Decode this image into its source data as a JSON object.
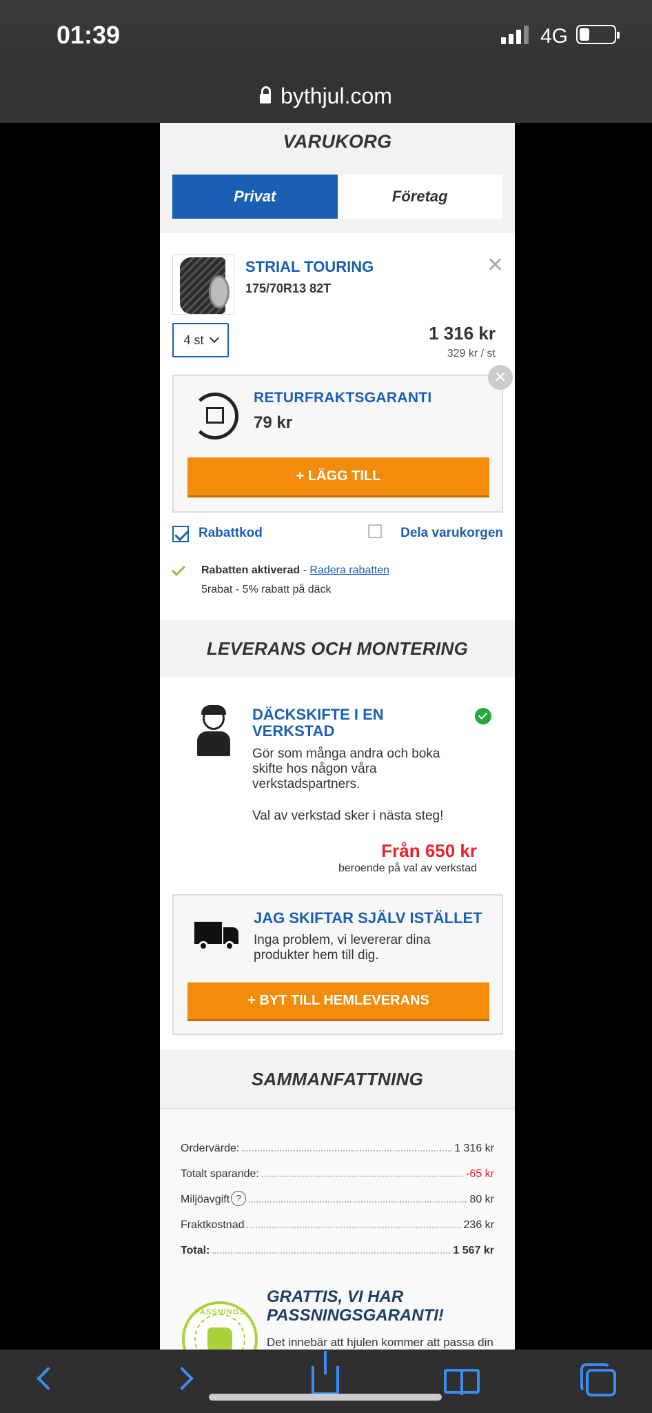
{
  "status": {
    "time": "01:39",
    "network": "4G"
  },
  "browser": {
    "url": "bythjul.com"
  },
  "cart": {
    "title": "VARUKORG",
    "tabs": {
      "private": "Privat",
      "business": "Företag"
    },
    "item": {
      "name": "STRIAL TOURING",
      "size": "175/70R13 82T",
      "qty": "4 st",
      "price": "1 316 kr",
      "unit_price": "329 kr / st"
    },
    "return_guarantee": {
      "title": "RETURFRAKTSGARANTI",
      "price": "79 kr",
      "add_label": "+ LÄGG TILL"
    },
    "discount_label": "Rabattkod",
    "share_label": "Dela varukorgen",
    "discount_active": "Rabatten aktiverad",
    "discount_sep": " - ",
    "discount_remove": "Radera rabatten",
    "discount_desc": "5rabat - 5% rabatt på däck"
  },
  "delivery": {
    "title": "LEVERANS OCH MONTERING",
    "workshop": {
      "title": "DÄCKSKIFTE I EN VERKSTAD",
      "desc": "Gör som många andra och boka skifte hos någon våra verkstadspartners.",
      "note": "Val av verkstad sker i nästa steg!",
      "price": "Från 650 kr",
      "price_sub": "beroende på val av verkstad"
    },
    "home": {
      "title": "JAG SKIFTAR SJÄLV ISTÄLLET",
      "desc": "Inga problem, vi levererar dina produkter hem till dig.",
      "button": "+ BYT TILL HEMLEVERANS"
    }
  },
  "summary": {
    "title": "SAMMANFATTNING",
    "rows": [
      {
        "label": "Ordervärde:",
        "value": "1 316 kr"
      },
      {
        "label": "Totalt sparande:",
        "value": "-65 kr"
      },
      {
        "label": "Miljöavgift",
        "value": "80 kr"
      },
      {
        "label": "Fraktkostnad",
        "value": "236 kr"
      },
      {
        "label": "Total:",
        "value": "1 567 kr"
      }
    ],
    "badge_text": "PASSNINGS",
    "guarantee_title": "GRATTIS, VI HAR PASSNINGSGARANTI!",
    "guarantee_desc": "Det innebär att hjulen kommer att passa din bil. Om du stöter på problem hjälper vi"
  },
  "colors": {
    "brand_blue": "#1a5fb4",
    "cta_orange": "#f28c0a",
    "price_red": "#e8232a",
    "ok_green": "#22aa3b"
  }
}
